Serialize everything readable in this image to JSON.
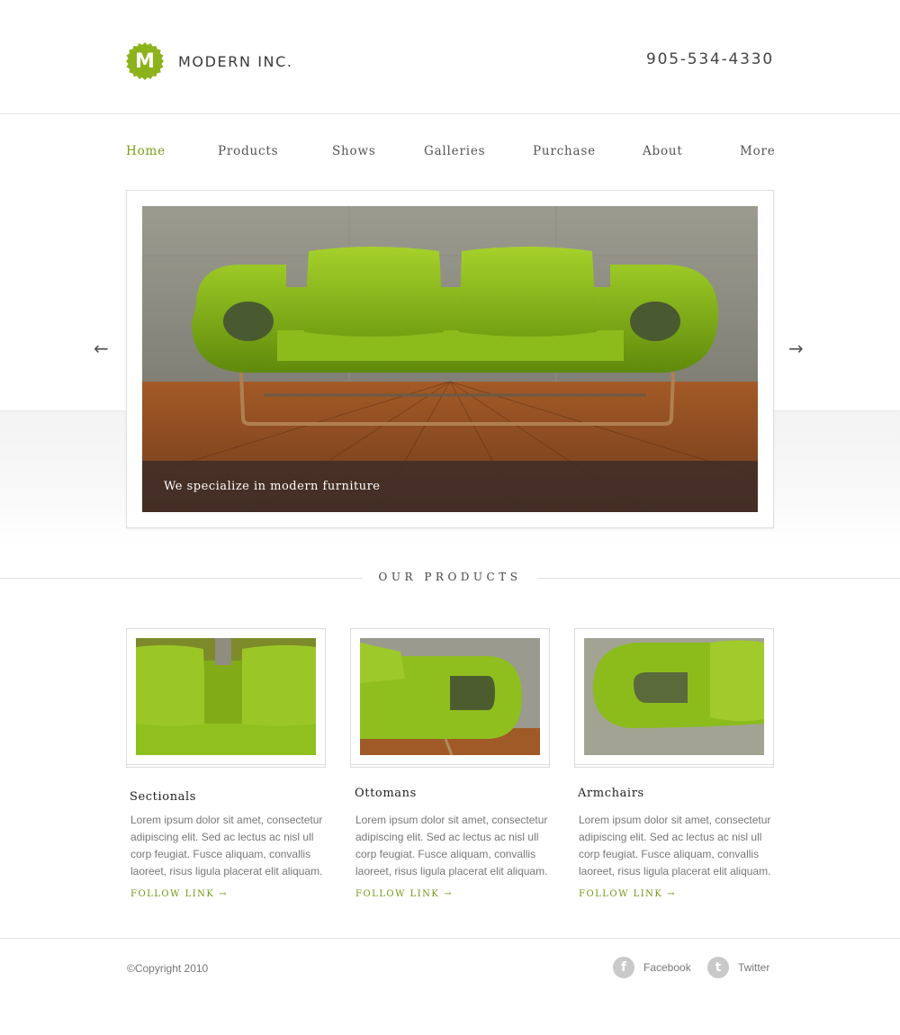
{
  "brand": {
    "name": "MODERN INC.",
    "logo_letter": "M",
    "accent_color": "#7da014"
  },
  "header": {
    "phone": "905-534-4330"
  },
  "nav": {
    "items": [
      {
        "label": "Home",
        "active": true
      },
      {
        "label": "Products"
      },
      {
        "label": "Shows"
      },
      {
        "label": "Galleries"
      },
      {
        "label": "Purchase"
      },
      {
        "label": "About"
      },
      {
        "label": "More"
      }
    ]
  },
  "slider": {
    "caption": "We specialize in modern furniture",
    "prev_arrow": "←",
    "next_arrow": "→"
  },
  "products_section": {
    "title": "OUR PRODUCTS",
    "items": [
      {
        "title": "Sectionals",
        "description": "Lorem ipsum dolor sit amet, consectetur adipiscing elit. Sed ac lectus ac nisl ull corp feugiat. Fusce aliquam, convallis laoreet, risus ligula placerat  elit aliquam.",
        "link": "FOLLOW LINK"
      },
      {
        "title": "Ottomans",
        "description": "Lorem ipsum dolor sit amet, consectetur adipiscing elit. Sed ac lectus ac nisl ull corp feugiat. Fusce aliquam, convallis laoreet, risus ligula placerat  elit aliquam.",
        "link": "FOLLOW LINK"
      },
      {
        "title": "Armchairs",
        "description": "Lorem ipsum dolor sit amet, consectetur adipiscing elit. Sed ac lectus ac nisl ull corp feugiat. Fusce aliquam, convallis laoreet, risus ligula placerat  elit aliquam.",
        "link": "FOLLOW LINK"
      }
    ]
  },
  "footer": {
    "copyright": "©Copyright 2010",
    "social": [
      {
        "label": "Facebook",
        "icon": "facebook-icon",
        "glyph": "f"
      },
      {
        "label": "Twitter",
        "icon": "twitter-icon",
        "glyph": "t"
      }
    ]
  }
}
